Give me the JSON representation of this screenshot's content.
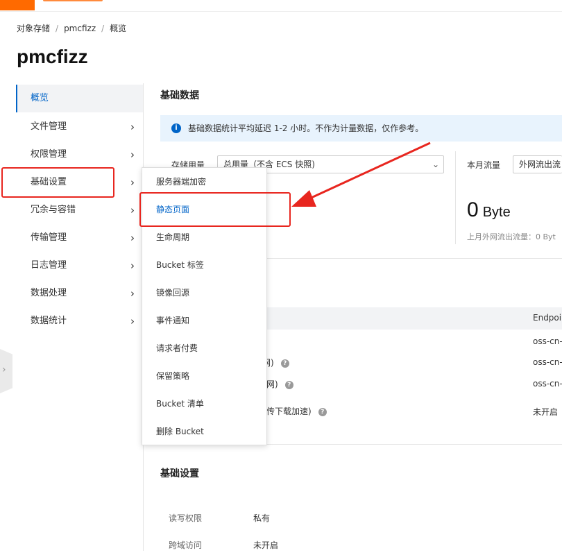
{
  "breadcrumb": {
    "items": [
      "对象存储",
      "pmcfizz",
      "概览"
    ],
    "separator": "/"
  },
  "page_title": "pmcfizz",
  "sidebar": {
    "items": [
      {
        "label": "概览",
        "active": true
      },
      {
        "label": "文件管理"
      },
      {
        "label": "权限管理"
      },
      {
        "label": "基础设置"
      },
      {
        "label": "冗余与容错"
      },
      {
        "label": "传输管理"
      },
      {
        "label": "日志管理"
      },
      {
        "label": "数据处理"
      },
      {
        "label": "数据统计"
      }
    ],
    "chevron": "›"
  },
  "basic_data": {
    "title": "基础数据",
    "info": "基础数据统计平均延迟 1-2 小时。不作为计量数据，仅作参考。",
    "storage_label": "存储用量",
    "storage_select": "总用量（不含 ECS 快照)",
    "traffic_label": "本月流量",
    "traffic_select": "外网流出流",
    "traffic_value": "0",
    "traffic_unit": "Byte",
    "last_month": "上月外网流出流量：0 Byt"
  },
  "access_table": {
    "header_endpoint": "Endpoi",
    "rows": [
      {
        "label": "",
        "endpoint": "oss-cn-"
      },
      {
        "label": "网)",
        "endpoint": "oss-cn-"
      },
      {
        "label": "网)",
        "endpoint": "oss-cn-"
      },
      {
        "label": "传下载加速)",
        "endpoint": "未开启"
      }
    ]
  },
  "basic_settings": {
    "title": "基础设置",
    "rows": [
      {
        "label": "读写权限",
        "value": "私有"
      },
      {
        "label": "跨域访问",
        "value": "未开启"
      }
    ]
  },
  "dropdown_menu": {
    "items": [
      "服务器端加密",
      "静态页面",
      "生命周期",
      "Bucket 标签",
      "镜像回源",
      "事件通知",
      "请求者付费",
      "保留策略",
      "Bucket 清单",
      "删除 Bucket"
    ]
  },
  "colors": {
    "accent": "#0064c8",
    "brand": "#ff6a00",
    "annotation": "#e8261f",
    "info_bg": "#e8f3fd"
  }
}
